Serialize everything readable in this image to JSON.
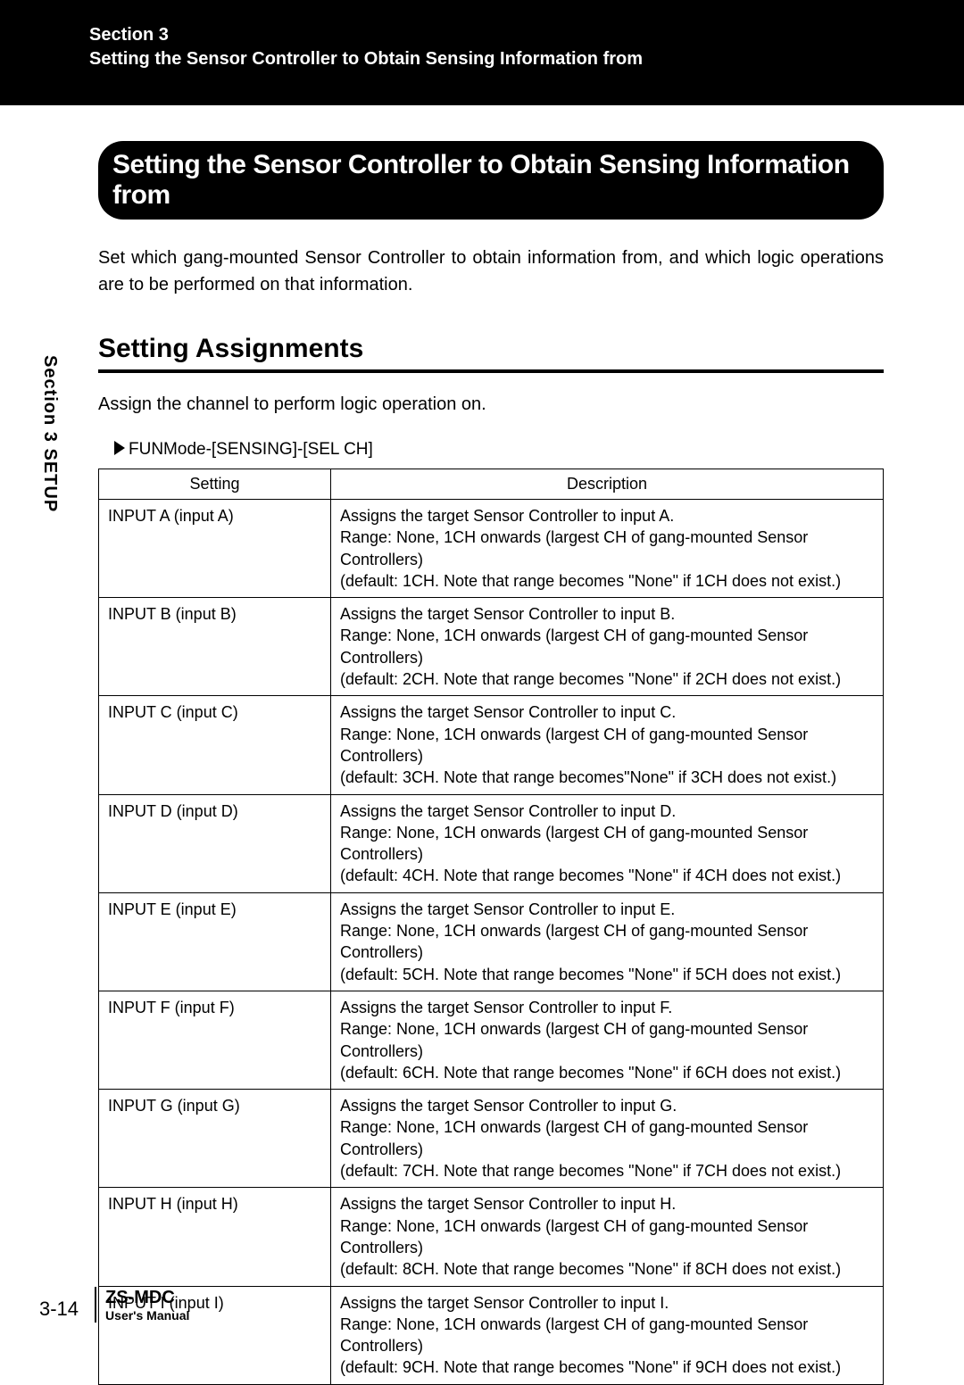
{
  "header": {
    "section_num": "Section 3",
    "section_title": "Setting the Sensor Controller to Obtain Sensing Information from"
  },
  "title_pill": "Setting the Sensor Controller to Obtain Sensing Information from",
  "intro": "Set which gang-mounted Sensor Controller to obtain information from, and which logic operations are to be performed on that information.",
  "subheading": "Setting Assignments",
  "assign_text": "Assign the channel to perform logic operation on.",
  "funmode": "FUNMode-[SENSING]-[SEL CH]",
  "table": {
    "headers": {
      "c1": "Setting",
      "c2": "Description"
    },
    "rows": [
      {
        "setting": "INPUT A (input A)",
        "desc_l1": "Assigns the target Sensor Controller to input A.",
        "desc_l2": "Range: None, 1CH onwards (largest CH of gang-mounted Sensor Controllers)",
        "desc_l3": "(default: 1CH. Note that range becomes \"None\" if 1CH does not exist.)"
      },
      {
        "setting": "INPUT B (input B)",
        "desc_l1": "Assigns the target Sensor Controller to input B.",
        "desc_l2": "Range: None, 1CH onwards (largest CH of gang-mounted Sensor Controllers)",
        "desc_l3": "(default: 2CH. Note that range becomes \"None\" if 2CH does not exist.)"
      },
      {
        "setting": "INPUT C (input C)",
        "desc_l1": "Assigns the target Sensor Controller to input C.",
        "desc_l2": "Range: None, 1CH onwards (largest CH of gang-mounted Sensor Controllers)",
        "desc_l3": "(default: 3CH. Note that range becomes\"None\" if 3CH does not exist.)"
      },
      {
        "setting": "INPUT D (input D)",
        "desc_l1": "Assigns the target Sensor Controller to input D.",
        "desc_l2": "Range: None, 1CH onwards (largest CH of gang-mounted Sensor Controllers)",
        "desc_l3": "(default: 4CH. Note that range becomes \"None\" if 4CH does not exist.)"
      },
      {
        "setting": "INPUT E (input E)",
        "desc_l1": "Assigns the target Sensor Controller to input E.",
        "desc_l2": "Range: None, 1CH onwards (largest CH of gang-mounted Sensor Controllers)",
        "desc_l3": "(default: 5CH. Note that range becomes \"None\" if 5CH does not exist.)"
      },
      {
        "setting": "INPUT F (input F)",
        "desc_l1": "Assigns the target Sensor Controller to input F.",
        "desc_l2": "Range: None, 1CH onwards (largest CH of gang-mounted Sensor Controllers)",
        "desc_l3": "(default: 6CH. Note that range becomes \"None\" if 6CH does not exist.)"
      },
      {
        "setting": "INPUT G (input G)",
        "desc_l1": "Assigns the target Sensor Controller to input G.",
        "desc_l2": "Range: None, 1CH onwards (largest CH of gang-mounted Sensor Controllers)",
        "desc_l3": "(default: 7CH. Note that range becomes \"None\" if 7CH does not exist.)"
      },
      {
        "setting": "INPUT H (input H)",
        "desc_l1": "Assigns the target Sensor Controller to input H.",
        "desc_l2": "Range: None, 1CH onwards (largest CH of gang-mounted Sensor Controllers)",
        "desc_l3": "(default: 8CH. Note that range becomes \"None\" if 8CH does not exist.)"
      },
      {
        "setting": "INPUT I (input I)",
        "desc_l1": "Assigns the target Sensor Controller to input I.",
        "desc_l2": "Range: None, 1CH onwards (largest CH of gang-mounted Sensor Controllers)",
        "desc_l3": "(default: 9CH. Note that range becomes \"None\" if 9CH does not exist.)"
      }
    ]
  },
  "side_tab": "Section 3   SETUP",
  "footer": {
    "page_num": "3-14",
    "model": "ZS-MDC",
    "manual": "User's Manual"
  }
}
